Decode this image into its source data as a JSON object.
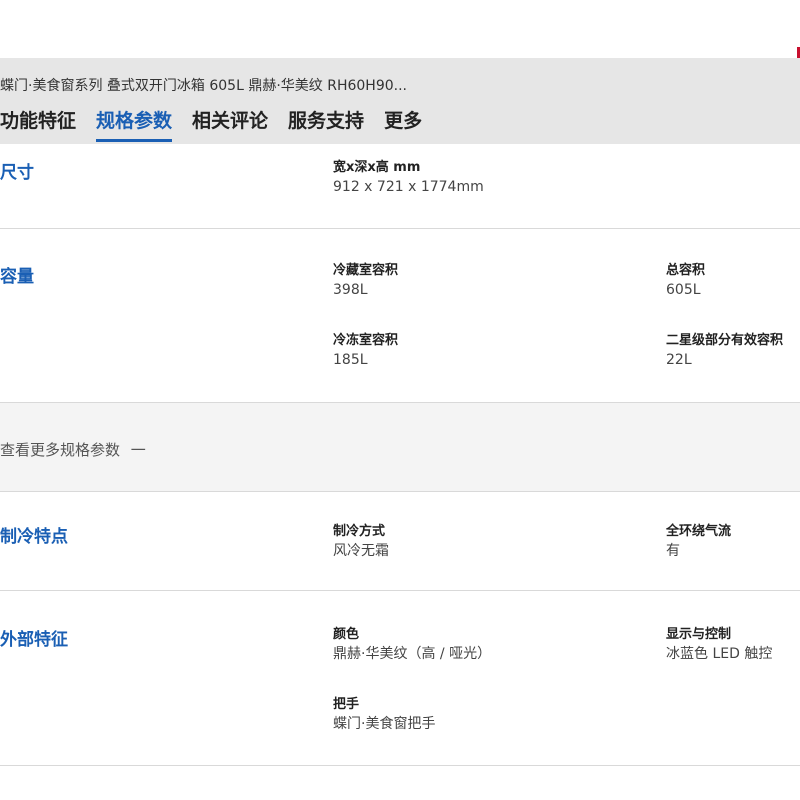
{
  "header": {
    "product_title": "蝶门·美食窗系列 叠式双开门冰箱 605L 鼎赫·华美纹 RH60H90...",
    "tabs": [
      "功能特征",
      "规格参数",
      "相关评论",
      "服务支持",
      "更多"
    ],
    "active_tab": "规格参数"
  },
  "colors": {
    "accent": "#1a5fb4",
    "header_bg": "#e6e6e6",
    "brand_red": "#c8102e"
  },
  "sections": {
    "dimensions": {
      "title": "尺寸",
      "specs": [
        {
          "label": "宽x深x高 mm",
          "value": "912 x 721 x 1774mm"
        }
      ]
    },
    "capacity": {
      "title": "容量",
      "specs": [
        {
          "label": "冷藏室容积",
          "value": "398L"
        },
        {
          "label": "总容积",
          "value": "605L"
        },
        {
          "label": "冷冻室容积",
          "value": "185L"
        },
        {
          "label": "二星级部分有效容积",
          "value": "22L"
        }
      ]
    },
    "more_specs": {
      "label": "查看更多规格参数",
      "icon": "minus-icon",
      "glyph": "一"
    },
    "cooling": {
      "title": "制冷特点",
      "specs": [
        {
          "label": "制冷方式",
          "value": "风冷无霜"
        },
        {
          "label": "全环绕气流",
          "value": "有"
        }
      ]
    },
    "exterior": {
      "title": "外部特征",
      "specs": [
        {
          "label": "颜色",
          "value": "鼎赫·华美纹（高 / 哑光）"
        },
        {
          "label": "显示与控制",
          "value": "冰蓝色 LED 触控"
        },
        {
          "label": "把手",
          "value": "蝶门·美食窗把手"
        }
      ]
    }
  }
}
